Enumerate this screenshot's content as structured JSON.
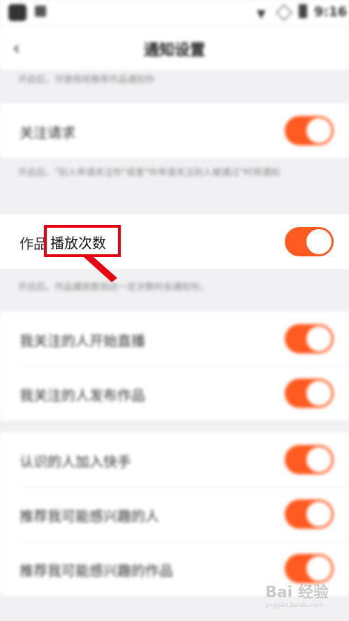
{
  "status_bar": {
    "time": "9:16",
    "wifi_icon": "wifi-icon",
    "signal_icon": "no-signal-icon",
    "battery_icon": "battery-icon"
  },
  "header": {
    "title": "通知设置",
    "back_icon": "chevron-left-icon"
  },
  "descriptions": {
    "top": "开启后，可使用将推荐作品通知你",
    "follow_request": "开启后，\"别人申请关注你\"或者\"你申请关注别人被通过\"时将通知",
    "play_count": "开启后，作品播放数到达一定次数时会通知你。"
  },
  "rows": {
    "follow_request": {
      "label": "关注请求",
      "on": true
    },
    "play_count": {
      "label_prefix": "作品",
      "label_highlight": "播放次数",
      "on": true
    },
    "live_start": {
      "label": "我关注的人开始直播",
      "on": true
    },
    "new_work": {
      "label": "我关注的人发布作品",
      "on": true
    },
    "acquaintance": {
      "label": "认识的人加入快手",
      "on": true
    },
    "recommend_people": {
      "label": "推荐我可能感兴趣的人",
      "on": true
    },
    "recommend_works": {
      "label": "推荐我可能感兴趣的作品",
      "on": true
    }
  },
  "colors": {
    "accent": "#ff5a1f",
    "annotation": "#e60012"
  },
  "watermark": {
    "text": "Bai 经验",
    "sub": "jingyan.baidu.com"
  }
}
